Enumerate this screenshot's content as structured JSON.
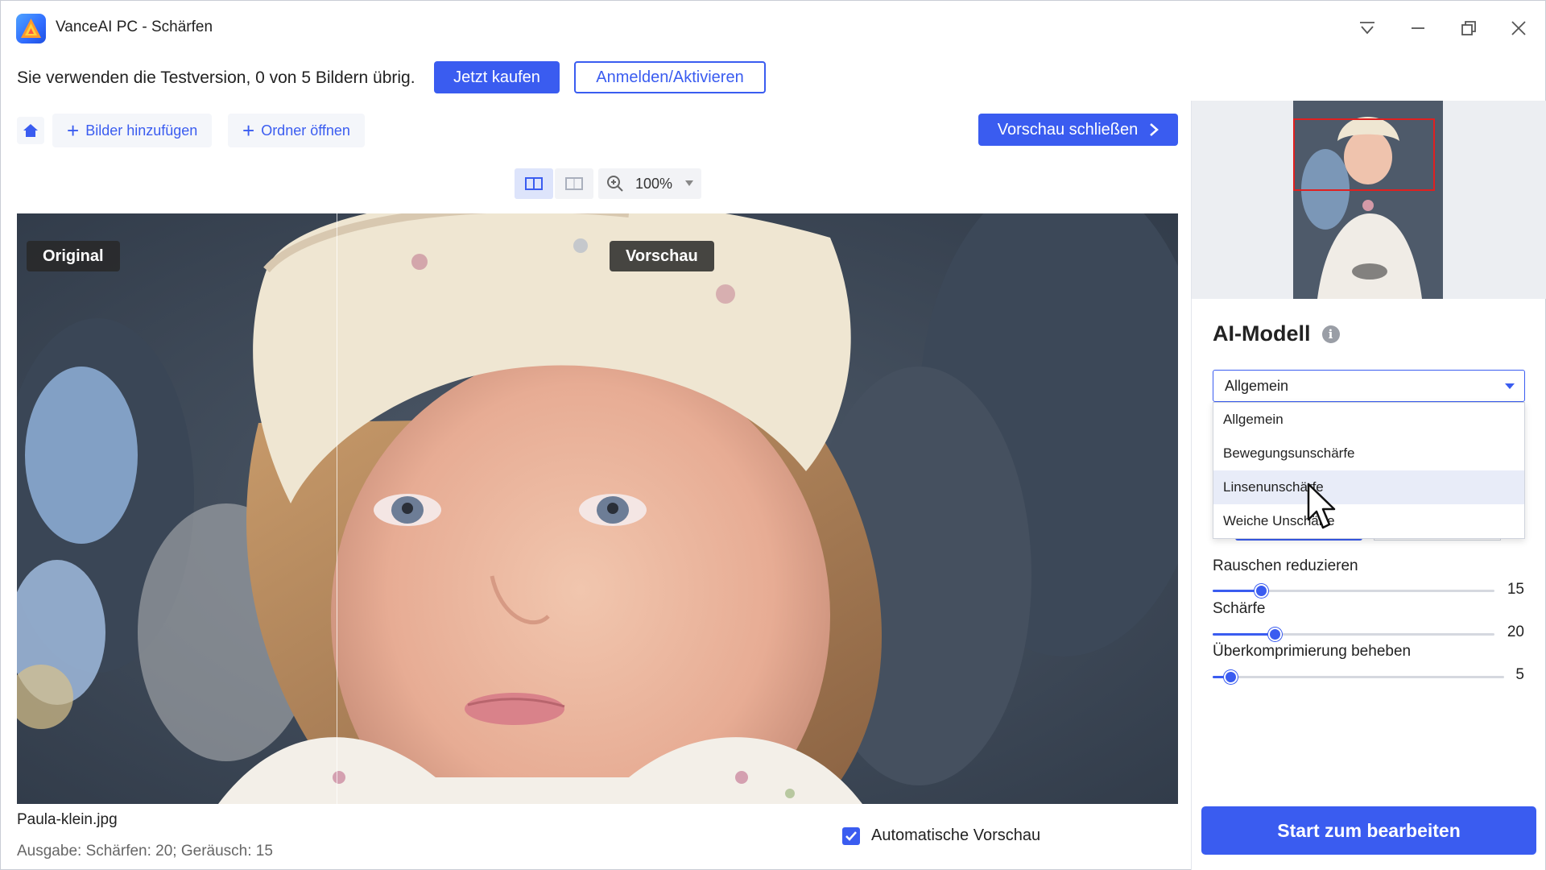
{
  "window": {
    "title": "VanceAI PC - Schärfen",
    "icons": {
      "logo": "vanceai-logo-icon",
      "filter": "filter-icon",
      "minimize": "minimize-icon",
      "restore": "restore-icon",
      "close": "close-icon"
    }
  },
  "trial": {
    "message": "Sie verwenden die Testversion, 0 von 5 Bildern übrig.",
    "buy_label": "Jetzt kaufen",
    "login_label": "Anmelden/Aktivieren"
  },
  "toolbar": {
    "add_images_label": "Bilder hinzufügen",
    "open_folder_label": "Ordner öffnen",
    "close_preview_label": "Vorschau schließen",
    "zoom": "100%"
  },
  "preview": {
    "original_tag": "Original",
    "preview_tag": "Vorschau",
    "filename": "Paula-klein.jpg",
    "output_info": "Ausgabe: Schärfen: 20; Geräusch: 15",
    "auto_preview_label": "Automatische Vorschau",
    "auto_preview_checked": true
  },
  "panel": {
    "ai_model_title": "AI-Modell",
    "selected_model": "Allgemein",
    "model_options": [
      "Allgemein",
      "Bewegungsunschärfe",
      "Linsenunschärfe",
      "Weiche Unschärfe"
    ],
    "hovered_option_index": 2,
    "sliders": [
      {
        "label": "Rauschen reduzieren",
        "value": "15",
        "fraction": 0.17
      },
      {
        "label": "Schärfe",
        "value": "20",
        "fraction": 0.22
      },
      {
        "label": "Überkomprimierung beheben",
        "value": "5",
        "fraction": 0.06
      }
    ],
    "start_label": "Start zum bearbeiten"
  },
  "colors": {
    "accent": "#3a5cf0",
    "frame_red": "#e02020"
  }
}
